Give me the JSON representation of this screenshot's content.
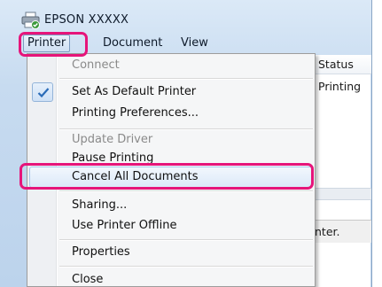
{
  "window": {
    "title": "EPSON XXXXX"
  },
  "menubar": {
    "printer": "Printer",
    "document": "Document",
    "view": "View"
  },
  "list": {
    "status_header": "Status",
    "status_value": "Printing",
    "statusbar_text": "nter."
  },
  "dropdown": {
    "connect": "Connect",
    "set_default": "Set As Default Printer",
    "preferences": "Printing Preferences...",
    "update_driver": "Update Driver",
    "pause": "Pause Printing",
    "cancel_all": "Cancel All Documents",
    "sharing": "Sharing...",
    "offline": "Use Printer Offline",
    "properties": "Properties",
    "close": "Close"
  },
  "colors": {
    "highlight": "#e6157a",
    "accent": "#2b6cb8"
  },
  "icons": {
    "app": "printer-icon",
    "check": "checkmark-icon"
  }
}
